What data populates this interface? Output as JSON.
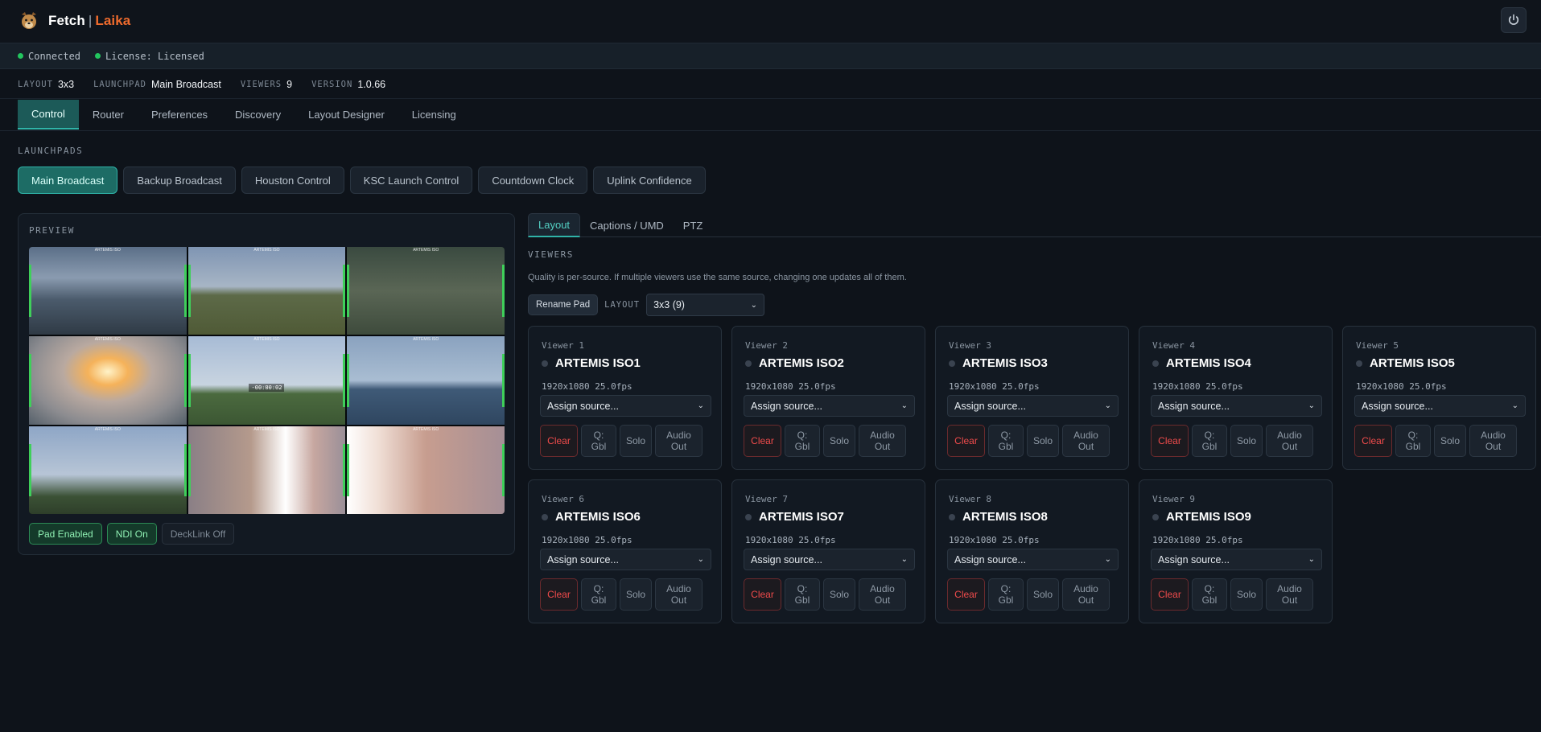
{
  "app": {
    "name": "Fetch",
    "separator": "|",
    "sub": "Laika"
  },
  "status": {
    "connected": "Connected",
    "license": "License: Licensed"
  },
  "info": [
    {
      "key": "LAYOUT",
      "value": "3x3"
    },
    {
      "key": "LAUNCHPAD",
      "value": "Main Broadcast"
    },
    {
      "key": "VIEWERS",
      "value": "9"
    },
    {
      "key": "VERSION",
      "value": "1.0.66"
    }
  ],
  "tabs": [
    "Control",
    "Router",
    "Preferences",
    "Discovery",
    "Layout Designer",
    "Licensing"
  ],
  "launchpads_label": "LAUNCHPADS",
  "launchpads": [
    "Main Broadcast",
    "Backup Broadcast",
    "Houston Control",
    "KSC Launch Control",
    "Countdown Clock",
    "Uplink Confidence"
  ],
  "preview": {
    "label": "PREVIEW",
    "tile_tag": "ARTEMIS ISO",
    "timecode": "-00:00:02",
    "badges": [
      "Pad Enabled",
      "NDI On",
      "DeckLink Off"
    ]
  },
  "subtabs": [
    "Layout",
    "Captions / UMD",
    "PTZ"
  ],
  "viewers_section": {
    "label": "VIEWERS",
    "note": "Quality is per-source. If multiple viewers use the same source, changing one updates all of them.",
    "rename_label": "Rename Pad",
    "layout_key": "LAYOUT",
    "layout_value": "3x3 (9)"
  },
  "viewers": [
    {
      "label": "Viewer 1",
      "name": "ARTEMIS ISO1",
      "res": "1920x1080 25.0fps",
      "source": "Assign source..."
    },
    {
      "label": "Viewer 2",
      "name": "ARTEMIS ISO2",
      "res": "1920x1080 25.0fps",
      "source": "Assign source..."
    },
    {
      "label": "Viewer 3",
      "name": "ARTEMIS ISO3",
      "res": "1920x1080 25.0fps",
      "source": "Assign source..."
    },
    {
      "label": "Viewer 4",
      "name": "ARTEMIS ISO4",
      "res": "1920x1080 25.0fps",
      "source": "Assign source..."
    },
    {
      "label": "Viewer 5",
      "name": "ARTEMIS ISO5",
      "res": "1920x1080 25.0fps",
      "source": "Assign source..."
    },
    {
      "label": "Viewer 6",
      "name": "ARTEMIS ISO6",
      "res": "1920x1080 25.0fps",
      "source": "Assign source..."
    },
    {
      "label": "Viewer 7",
      "name": "ARTEMIS ISO7",
      "res": "1920x1080 25.0fps",
      "source": "Assign source..."
    },
    {
      "label": "Viewer 8",
      "name": "ARTEMIS ISO8",
      "res": "1920x1080 25.0fps",
      "source": "Assign source..."
    },
    {
      "label": "Viewer 9",
      "name": "ARTEMIS ISO9",
      "res": "1920x1080 25.0fps",
      "source": "Assign source..."
    }
  ],
  "viewer_buttons": {
    "clear": "Clear",
    "q1": "Q:",
    "q2": "Gbl",
    "solo": "Solo",
    "audio1": "Audio",
    "audio2": "Out"
  },
  "colors": {
    "accent": "#2fb3a8",
    "brand": "#ef6b2d",
    "ok": "#22c55e",
    "danger": "#ef4b4b"
  }
}
